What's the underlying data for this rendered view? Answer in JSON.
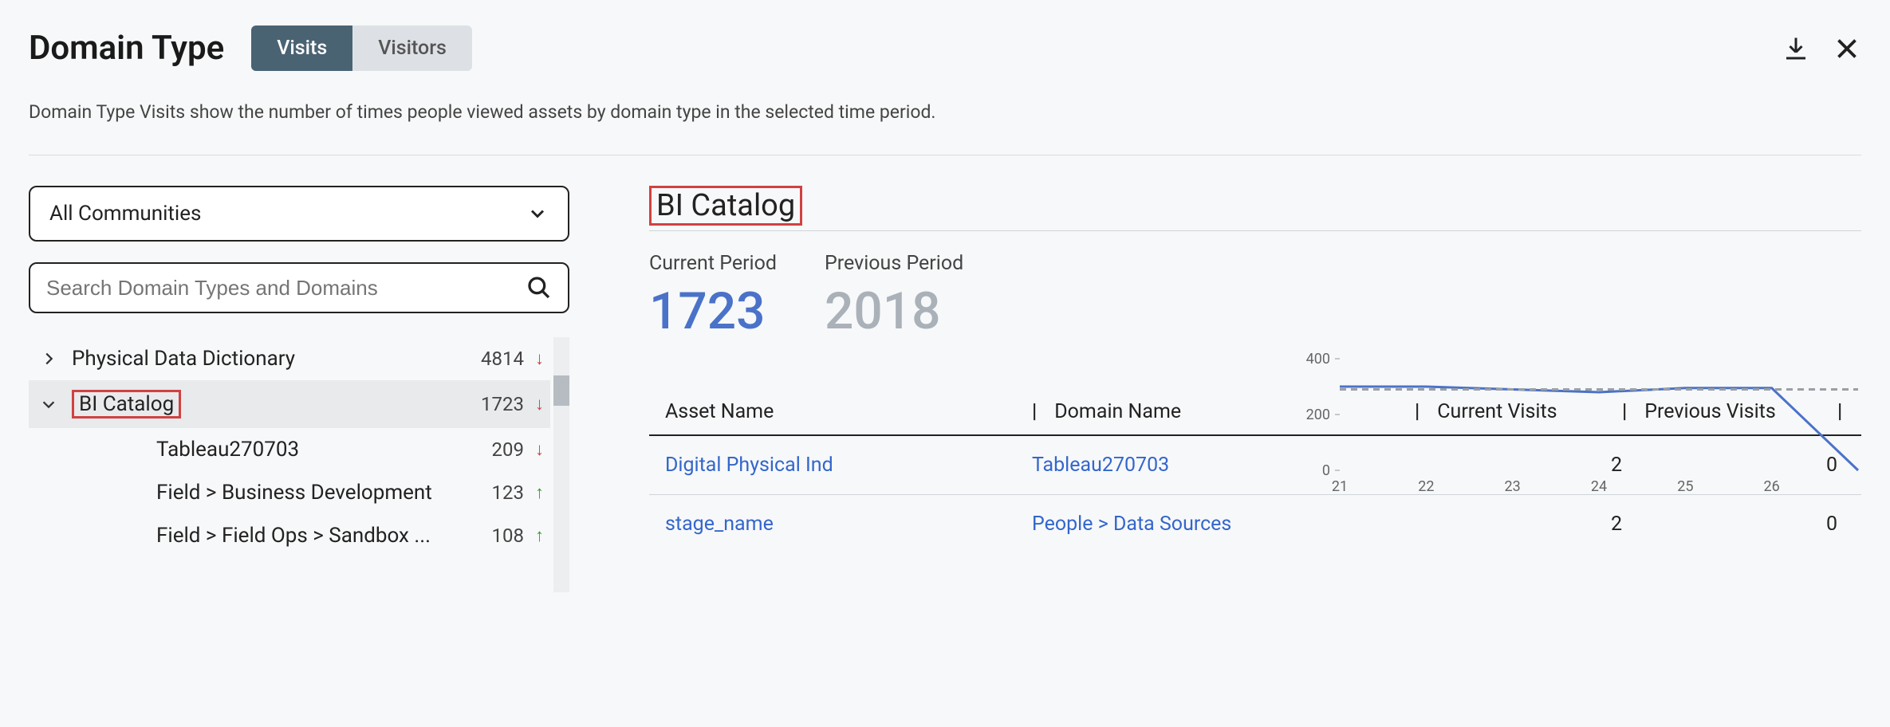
{
  "header": {
    "title": "Domain Type",
    "tabs": [
      {
        "label": "Visits",
        "active": true
      },
      {
        "label": "Visitors",
        "active": false
      }
    ]
  },
  "description": "Domain Type Visits show the number of times people viewed assets by domain type in the selected time period.",
  "filter": {
    "community": "All Communities",
    "search_placeholder": "Search Domain Types and Domains"
  },
  "tree": [
    {
      "label": "Physical Data Dictionary",
      "count": "4814",
      "trend": "down",
      "expanded": false,
      "indent": 0,
      "selected": false
    },
    {
      "label": "BI Catalog",
      "count": "1723",
      "trend": "down",
      "expanded": true,
      "indent": 0,
      "selected": true,
      "highlight": true
    },
    {
      "label": "Tableau270703",
      "count": "209",
      "trend": "down",
      "indent": 1
    },
    {
      "label": "Field > Business Development",
      "count": "123",
      "trend": "up",
      "indent": 1
    },
    {
      "label": "Field > Field Ops > Sandbox ...",
      "count": "108",
      "trend": "up",
      "indent": 1
    }
  ],
  "detail": {
    "title": "BI Catalog",
    "current_label": "Current Period",
    "current_value": "1723",
    "previous_label": "Previous Period",
    "previous_value": "2018"
  },
  "table": {
    "headers": [
      "Asset Name",
      "Domain Name",
      "Current Visits",
      "Previous Visits"
    ],
    "rows": [
      {
        "asset": "Digital Physical Ind",
        "domain": "Tableau270703",
        "current": "2",
        "previous": "0"
      },
      {
        "asset": "stage_name",
        "domain": "People > Data Sources",
        "current": "2",
        "previous": "0"
      }
    ]
  },
  "chart_data": {
    "type": "line",
    "x": [
      21,
      22,
      23,
      24,
      25,
      26,
      27
    ],
    "series": [
      {
        "name": "current",
        "values": [
          300,
          300,
          290,
          280,
          295,
          295,
          0
        ],
        "style": "solid",
        "color": "#4a72c9"
      },
      {
        "name": "previous",
        "values": [
          290,
          290,
          290,
          290,
          290,
          290,
          290
        ],
        "style": "dashed",
        "color": "#9aa0a6"
      }
    ],
    "ylim": [
      0,
      400
    ],
    "yticks": [
      0,
      200,
      400
    ],
    "xticks": [
      21,
      22,
      23,
      24,
      25,
      26
    ]
  }
}
